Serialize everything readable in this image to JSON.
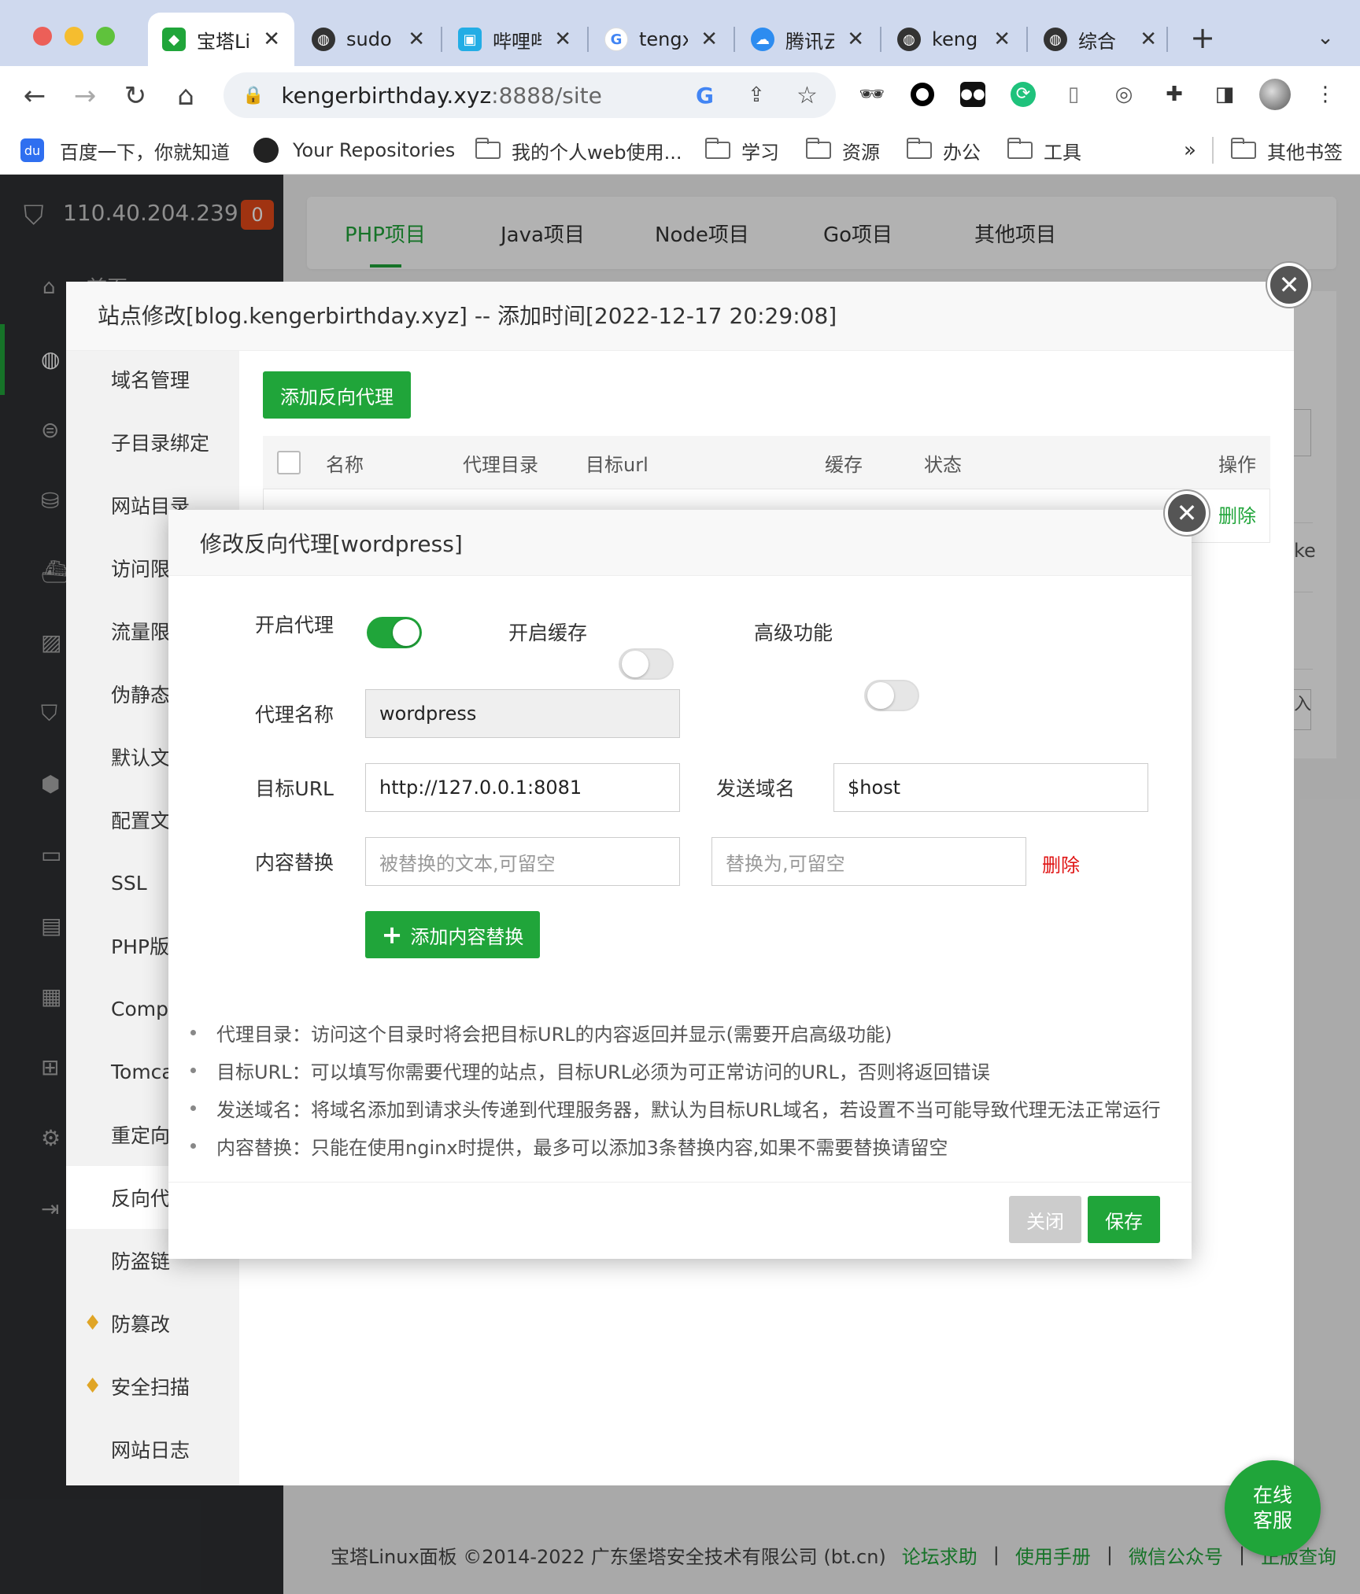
{
  "browser": {
    "tabs": [
      {
        "label": "宝塔Linux",
        "icon": "baota-icon",
        "color": "#20a53a",
        "active": true
      },
      {
        "label": "sudo",
        "icon": "globe-icon",
        "color": "#333333"
      },
      {
        "label": "哔哩哔哩",
        "icon": "bilibili-icon",
        "color": "#23ade5"
      },
      {
        "label": "tengx",
        "icon": "google-icon",
        "color": "#4285f4"
      },
      {
        "label": "腾讯云",
        "icon": "tencent-cloud-icon",
        "color": "#2d8cf0"
      },
      {
        "label": "keng",
        "icon": "globe-icon",
        "color": "#333333"
      },
      {
        "label": "综合",
        "icon": "globe-icon",
        "color": "#333333"
      }
    ],
    "url_host": "kengerbirthday.xyz",
    "url_path": ":8888/site",
    "bookmarks": {
      "baidu": "百度一下，你就知道",
      "github": "Your Repositories",
      "folder1": "我的个人web使用...",
      "folder2": "学习",
      "folder3": "资源",
      "folder4": "办公",
      "folder5": "工具",
      "more": "»",
      "other": "其他书签"
    }
  },
  "panel": {
    "server_ip": "110.40.204.239",
    "alert_count": "0",
    "sidebar_peek": "首页",
    "tabs": [
      "PHP项目",
      "Java项目",
      "Node项目",
      "Go项目",
      "其他项目"
    ],
    "bg_peek": [
      "ke",
      "入"
    ]
  },
  "site_modal": {
    "title": "站点修改[blog.kengerbirthday.xyz] -- 添加时间[2022-12-17 20:29:08]",
    "menu": [
      "域名管理",
      "子目录绑定",
      "网站目录",
      "访问限制",
      "流量限制",
      "伪静态",
      "默认文档",
      "配置文件",
      "SSL",
      "PHP版本",
      "Composer",
      "Tomcat",
      "重定向",
      "反向代理",
      "防盗链",
      "防篡改",
      "安全扫描",
      "网站日志"
    ],
    "add_proxy_button": "添加反向代理",
    "table_headers": [
      "名称",
      "代理目录",
      "目标url",
      "缓存",
      "状态",
      "操作"
    ],
    "row_action": "删除"
  },
  "proxy_modal": {
    "title": "修改反向代理[wordpress]",
    "enable_proxy_label": "开启代理",
    "enable_cache_label": "开启缓存",
    "advanced_label": "高级功能",
    "enable_proxy": true,
    "enable_cache": false,
    "advanced": false,
    "name_label": "代理名称",
    "name_value": "wordpress",
    "target_url_label": "目标URL",
    "target_url_value": "http://127.0.0.1:8081",
    "send_domain_label": "发送域名",
    "send_domain_value": "$host",
    "replace_label": "内容替换",
    "replace_from_placeholder": "被替换的文本,可留空",
    "replace_to_placeholder": "替换为,可留空",
    "delete_link": "删除",
    "add_replace_button": "添加内容替换",
    "tips": [
      "代理目录：访问这个目录时将会把目标URL的内容返回并显示(需要开启高级功能)",
      "目标URL：可以填写你需要代理的站点，目标URL必须为可正常访问的URL，否则将返回错误",
      "发送域名：将域名添加到请求头传递到代理服务器，默认为目标URL域名，若设置不当可能导致代理无法正常运行",
      "内容替换：只能在使用nginx时提供，最多可以添加3条替换内容,如果不需要替换请留空"
    ],
    "close_button": "关闭",
    "save_button": "保存"
  },
  "footer": {
    "copyright": "宝塔Linux面板 ©2014-2022 广东堡塔安全技术有限公司 (bt.cn)",
    "links": [
      "论坛求助",
      "使用手册",
      "微信公众号",
      "正版查询"
    ],
    "sep": "|"
  },
  "chat": {
    "line1": "在线",
    "line2": "客服"
  },
  "colors": {
    "brand_green": "#20a53a",
    "danger_red": "#e01414",
    "sidebar_dark": "#2f3033"
  }
}
